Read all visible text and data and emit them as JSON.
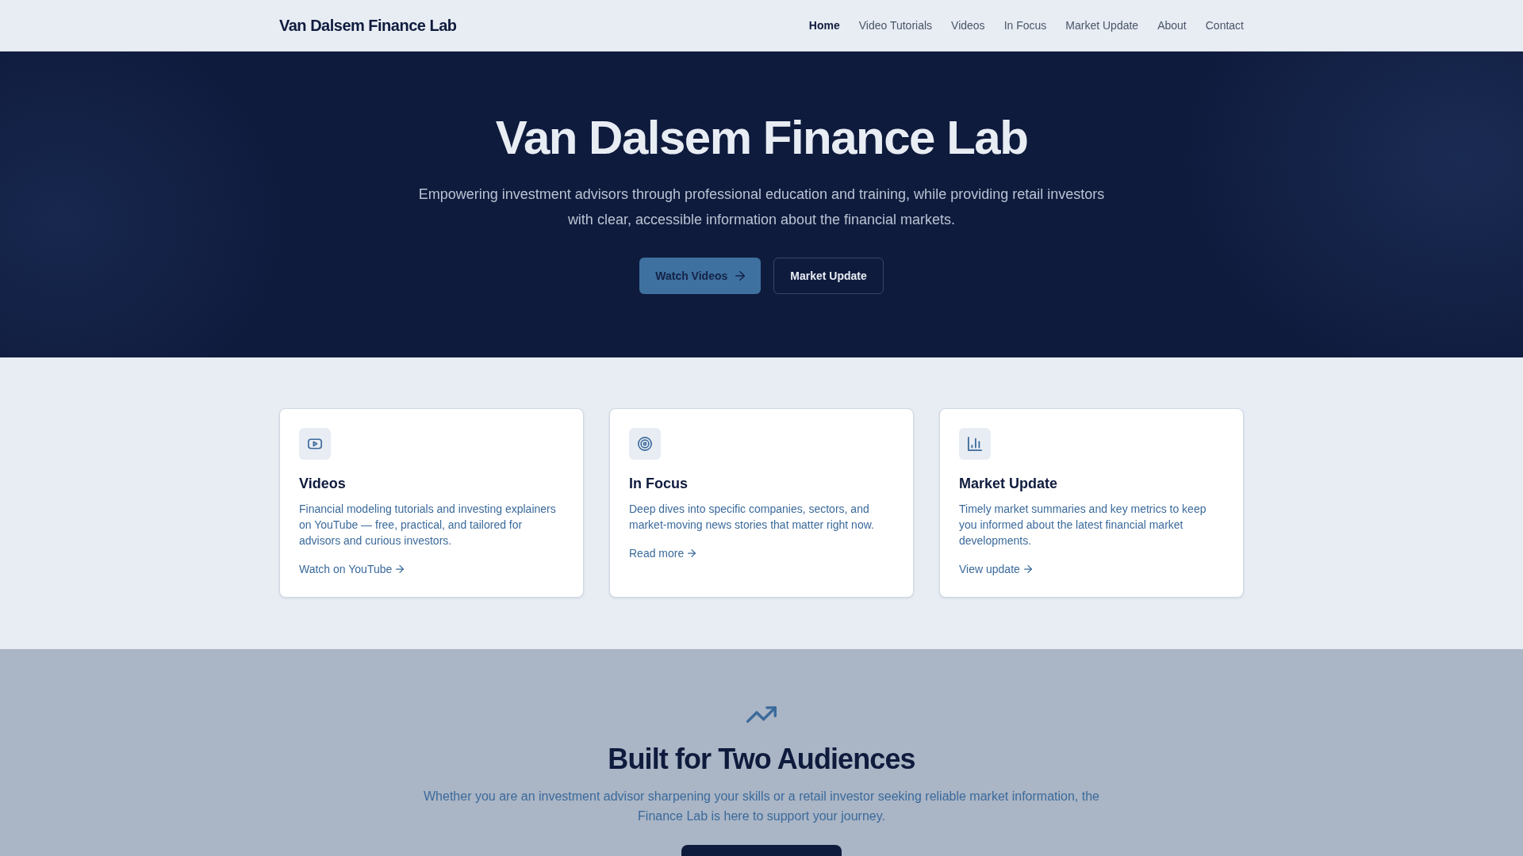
{
  "header": {
    "logo": "Van Dalsem Finance Lab",
    "nav": [
      {
        "label": "Home",
        "selected": true
      },
      {
        "label": "Video Tutorials",
        "selected": false
      },
      {
        "label": "Videos",
        "selected": false
      },
      {
        "label": "In Focus",
        "selected": false
      },
      {
        "label": "Market Update",
        "selected": false
      },
      {
        "label": "About",
        "selected": false
      },
      {
        "label": "Contact",
        "selected": false
      }
    ]
  },
  "hero": {
    "title": "Van Dalsem Finance Lab",
    "subtitle": "Empowering investment advisors through professional education and training, while providing retail investors with clear, accessible information about the financial markets.",
    "buttons": [
      {
        "label": "Watch Videos",
        "kind": "primary",
        "arrow": true
      },
      {
        "label": "Market Update",
        "kind": "outline",
        "arrow": false
      }
    ]
  },
  "features": [
    {
      "title": "Videos",
      "description": "Financial modeling tutorials and investing explainers on YouTube — free, practical, and tailored for advisors and curious investors.",
      "link": "Watch on YouTube"
    },
    {
      "title": "In Focus",
      "description": "Deep dives into specific companies, sectors, and market-moving news stories that matter right now.",
      "link": "Read more"
    },
    {
      "title": "Market Update",
      "description": "Timely market summaries and key metrics to keep you informed about the latest financial market developments.",
      "link": "View update"
    }
  ],
  "audiences": {
    "title": "Built for Two Audiences",
    "description": "Whether you are an investment advisor sharpening your skills or a retail investor seeking reliable market information, the Finance Lab is here to support your journey."
  }
}
